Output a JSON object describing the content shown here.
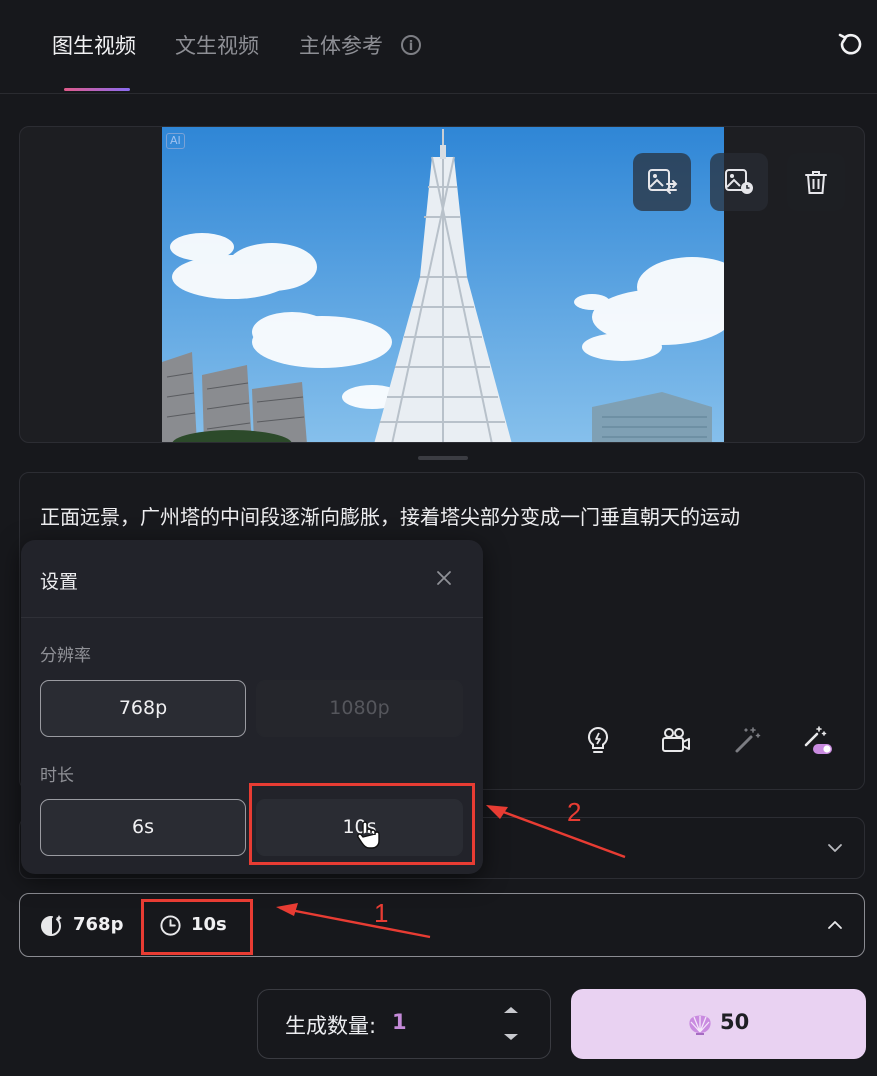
{
  "tabs": [
    {
      "label": "图生视频",
      "active": true
    },
    {
      "label": "文生视频",
      "active": false
    },
    {
      "label": "主体参考",
      "active": false
    }
  ],
  "image_card": {
    "ai_badge": "AI",
    "actions": [
      "replace-image-icon",
      "image-history-icon",
      "trash-icon"
    ]
  },
  "prompt": {
    "text": "正面远景，广州塔的中间段逐渐向膨胀，接着塔尖部分变成一门垂直朝天的运动"
  },
  "settings_popup": {
    "title": "设置",
    "resolution_label": "分辨率",
    "resolution_options": [
      {
        "label": "768p",
        "state": "selected"
      },
      {
        "label": "1080p",
        "state": "disabled"
      }
    ],
    "duration_label": "时长",
    "duration_options": [
      {
        "label": "6s",
        "state": "selected"
      },
      {
        "label": "10s",
        "state": "hover"
      }
    ]
  },
  "settings_bar": {
    "resolution": "768p",
    "duration": "10s"
  },
  "generate": {
    "quantity_label": "生成数量:",
    "quantity_value": "1",
    "cost": "50"
  },
  "annotations": {
    "step1": "1",
    "step2": "2",
    "color": "#e83c33"
  },
  "colors": {
    "background": "#17181c",
    "generate_button": "#e9d2f2",
    "quantity_accent": "#c48ad8"
  }
}
